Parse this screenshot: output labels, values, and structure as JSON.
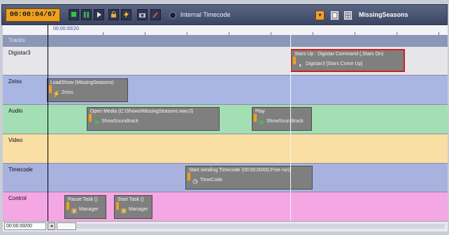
{
  "toolbar": {
    "time": "00:00:04/67",
    "timecode_source": "Internal Timecode",
    "show_name": "MissingSeasons",
    "icons": [
      "stop-icon",
      "pause-icon",
      "play-icon",
      "lock-icon",
      "flash-icon",
      "camera-icon",
      "tool-icon",
      "timecode-dot-icon",
      "dropdown-icon",
      "window-icon",
      "grid-icon"
    ]
  },
  "ruler": {
    "position": "00:00:00/20"
  },
  "tracks_header": "Tracks",
  "lanes": [
    {
      "name": "Digistar3",
      "color": "#e6e6ea"
    },
    {
      "name": "Zeiss",
      "color": "#a9b6e4"
    },
    {
      "name": "Audio",
      "color": "#a4dfb3"
    },
    {
      "name": "Video",
      "color": "#f9dfa4"
    },
    {
      "name": "Timecode",
      "color": "#a9b1de"
    },
    {
      "name": "Control",
      "color": "#f5a6e4"
    }
  ],
  "events": [
    {
      "title": "Stars Up : Digistar Command (,Stars On)",
      "device": "Digistar3 [Stars Come Up]",
      "icon": "digistar-icon",
      "selected": true
    },
    {
      "title": "LoadShow (MissingSeasons)",
      "device": "Zeiss",
      "icon": "zeiss-icon"
    },
    {
      "title": "Open Media (C:\\Shows\\MissingSeasons.wav,0)",
      "device": "ShowSoundtrack",
      "icon": "soundtrack-icon"
    },
    {
      "title": "Play",
      "device": "ShowSoundtrack",
      "icon": "soundtrack-icon"
    },
    {
      "title": "Start sending Timecode (00:00:00/00,Free run)",
      "device": "TimeCode",
      "icon": "timecode-icon"
    },
    {
      "title": "Pause Task ()",
      "device": "Manager",
      "icon": "manager-icon"
    },
    {
      "title": "Start Task ()",
      "device": "Manager",
      "icon": "manager-icon"
    }
  ],
  "bottom": {
    "time": "00:00:00/00"
  }
}
